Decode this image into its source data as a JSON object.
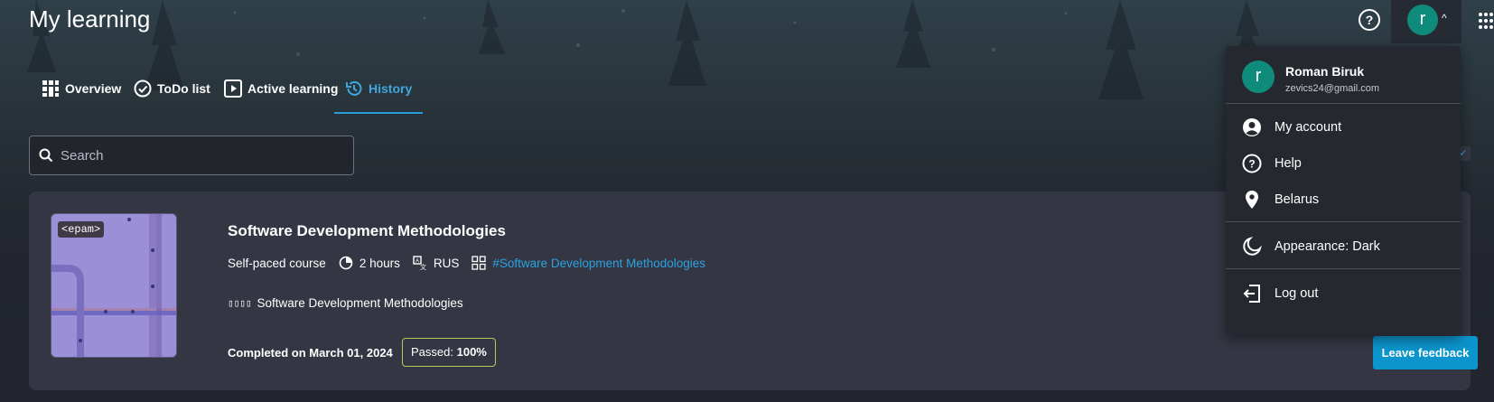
{
  "header": {
    "title": "My learning",
    "help_icon": "help-circle-icon",
    "avatar_initial": "r",
    "apps_icon": "apps-grid-icon"
  },
  "tabs": [
    {
      "label": "Overview",
      "icon": "grid-icon",
      "active": false
    },
    {
      "label": "ToDo list",
      "icon": "check-circle-icon",
      "active": false
    },
    {
      "label": "Active learning",
      "icon": "play-icon",
      "active": false
    },
    {
      "label": "History",
      "icon": "history-icon",
      "active": true
    }
  ],
  "search": {
    "placeholder": "Search",
    "value": ""
  },
  "course": {
    "logo_text": "<epam>",
    "title": "Software Development Methodologies",
    "type": "Self-paced course",
    "duration": "2 hours",
    "language": "RUS",
    "tag": "#Software Development Methodologies",
    "provider_prefix": "▯▯▯▯",
    "provider_name": "Software Development Methodologies",
    "completed": "Completed on March 01, 2024",
    "passed_label": "Passed:",
    "passed_value": "100%",
    "feedback_button": "Leave feedback"
  },
  "user_menu": {
    "avatar_initial": "r",
    "name": "Roman Biruk",
    "email": "zevics24@gmail.com",
    "items": [
      {
        "label": "My account",
        "icon": "account-circle-icon"
      },
      {
        "label": "Help",
        "icon": "help-circle-icon"
      },
      {
        "label": "Belarus",
        "icon": "location-pin-icon"
      },
      {
        "label": "Appearance: Dark",
        "icon": "moon-icon"
      },
      {
        "label": "Log out",
        "icon": "logout-icon"
      }
    ]
  },
  "colors": {
    "accent": "#2aa3e0",
    "avatar": "#0f8b7c",
    "card": "#343643",
    "passed_border": "#b2cc5a",
    "feedback_button": "#0c94cc"
  }
}
